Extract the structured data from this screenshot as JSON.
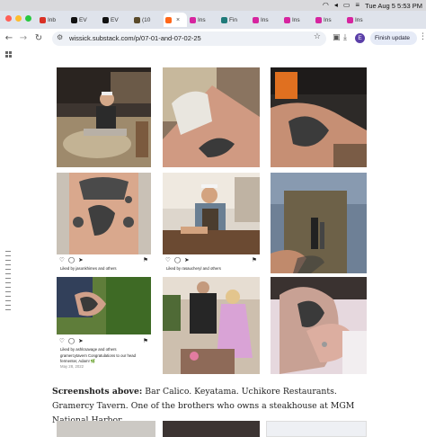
{
  "menubar": {
    "date_time": "Tue Aug 5  5:53 PM"
  },
  "tabs": [
    {
      "label": "Inb",
      "icon": "gmail-icon",
      "color": "#d93025",
      "active": false
    },
    {
      "label": "EV",
      "icon": "x-icon",
      "color": "#111111",
      "active": false
    },
    {
      "label": "EV",
      "icon": "x-icon",
      "color": "#111111",
      "active": false
    },
    {
      "label": "(10",
      "icon": "app-icon",
      "color": "#5a4a2a",
      "active": false
    },
    {
      "label": "",
      "icon": "substack-icon",
      "color": "#ff6719",
      "active": true
    },
    {
      "label": "Ins",
      "icon": "instagram-icon",
      "color": "#d6249f",
      "active": false
    },
    {
      "label": "Fin",
      "icon": "perplexity-icon",
      "color": "#1f7a7a",
      "active": false
    },
    {
      "label": "Ins",
      "icon": "instagram-icon",
      "color": "#d6249f",
      "active": false
    },
    {
      "label": "Ins",
      "icon": "instagram-icon",
      "color": "#d6249f",
      "active": false
    },
    {
      "label": "Ins",
      "icon": "instagram-icon",
      "color": "#d6249f",
      "active": false
    },
    {
      "label": "Ins",
      "icon": "instagram-icon",
      "color": "#d6249f",
      "active": false
    }
  ],
  "toolbar": {
    "url": "wissick.substack.com/p/07-01-and-07-02-25",
    "profile_initial": "E",
    "finish_update_label": "Finish update"
  },
  "photos": {
    "p5_liked": "Liked by jasonkhimes and others",
    "p8_liked": "Liked by ashlcsavage and others",
    "p8_comment": "gramercytavern Congratulations to our head fermenter, Adam! 🌿",
    "p8_date": "May 28, 2022",
    "p6_liked": "Liked by rasaucheryl and others"
  },
  "caption": {
    "lead": "Screenshots above:",
    "text": " Bar Calico. Keyatama. Uchikore Restaurants. Gramercy Tavern. One of the brothers who owns a steakhouse at MGM National Harbor."
  },
  "colors": {
    "accent": "#1a73e8",
    "menubar": "#d9d9dc",
    "tabstrip": "#dfe3eb"
  }
}
